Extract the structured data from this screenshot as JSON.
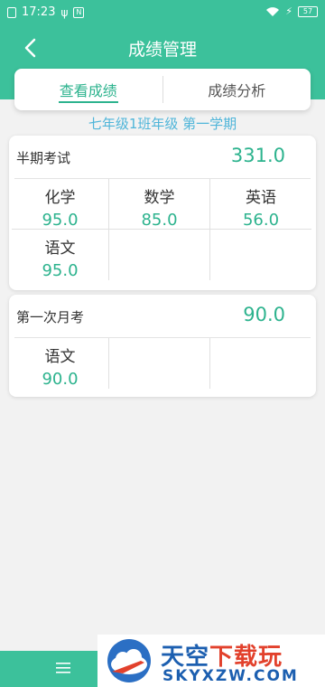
{
  "status_bar": {
    "time": "17:23",
    "battery": "57"
  },
  "header": {
    "title": "成绩管理"
  },
  "tabs": [
    {
      "label": "查看成绩",
      "active": true
    },
    {
      "label": "成绩分析",
      "active": false
    }
  ],
  "class_term": "七年级1班年级 第一学期",
  "exams": [
    {
      "name": "半期考试",
      "total": "331.0",
      "subjects": [
        {
          "name": "化学",
          "score": "95.0"
        },
        {
          "name": "数学",
          "score": "85.0"
        },
        {
          "name": "英语",
          "score": "56.0"
        },
        {
          "name": "语文",
          "score": "95.0"
        }
      ]
    },
    {
      "name": "第一次月考",
      "total": "90.0",
      "subjects": [
        {
          "name": "语文",
          "score": "90.0"
        }
      ]
    }
  ],
  "watermark": {
    "title_part1": "天空",
    "title_part2": "下载玩",
    "url": "SKYXZW.COM"
  },
  "colors": {
    "primary": "#3cc19b",
    "accent_text": "#2db38e",
    "subtitle": "#4fb5d9"
  }
}
